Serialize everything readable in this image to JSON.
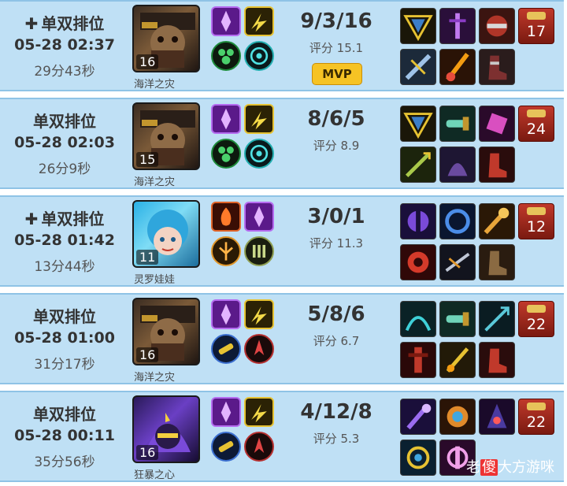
{
  "matches": [
    {
      "mode": "单双排位",
      "plus": true,
      "date": "05-28 02:37",
      "duration": "29分43秒",
      "champion": "海洋之灾",
      "level": "16",
      "kda": "9/3/16",
      "score": "评分 15.1",
      "mvp": "MVP",
      "ward_count": "17"
    },
    {
      "mode": "单双排位",
      "plus": false,
      "date": "05-28 02:03",
      "duration": "26分9秒",
      "champion": "海洋之灾",
      "level": "15",
      "kda": "8/6/5",
      "score": "评分 8.9",
      "ward_count": "24"
    },
    {
      "mode": "单双排位",
      "plus": true,
      "date": "05-28 01:42",
      "duration": "13分44秒",
      "champion": "灵罗娃娃",
      "level": "11",
      "kda": "3/0/1",
      "score": "评分 11.3",
      "ward_count": "12"
    },
    {
      "mode": "单双排位",
      "plus": false,
      "date": "05-28 01:00",
      "duration": "31分17秒",
      "champion": "海洋之灾",
      "level": "16",
      "kda": "5/8/6",
      "score": "评分 6.7",
      "ward_count": "22"
    },
    {
      "mode": "单双排位",
      "plus": false,
      "date": "05-28 00:11",
      "duration": "35分56秒",
      "champion": "狂暴之心",
      "level": "16",
      "kda": "4/12/8",
      "score": "评分 5.3",
      "ward_count": "22"
    }
  ],
  "plus_symbol": "✚",
  "watermark": {
    "prefix": "老",
    "badge": "傻",
    "suffix": "大方",
    "tail": "游咪"
  },
  "colors": {
    "row_bg": "#bfe0f5",
    "mvp_bg": "#f6c324",
    "ward_red": "#c0392b"
  }
}
